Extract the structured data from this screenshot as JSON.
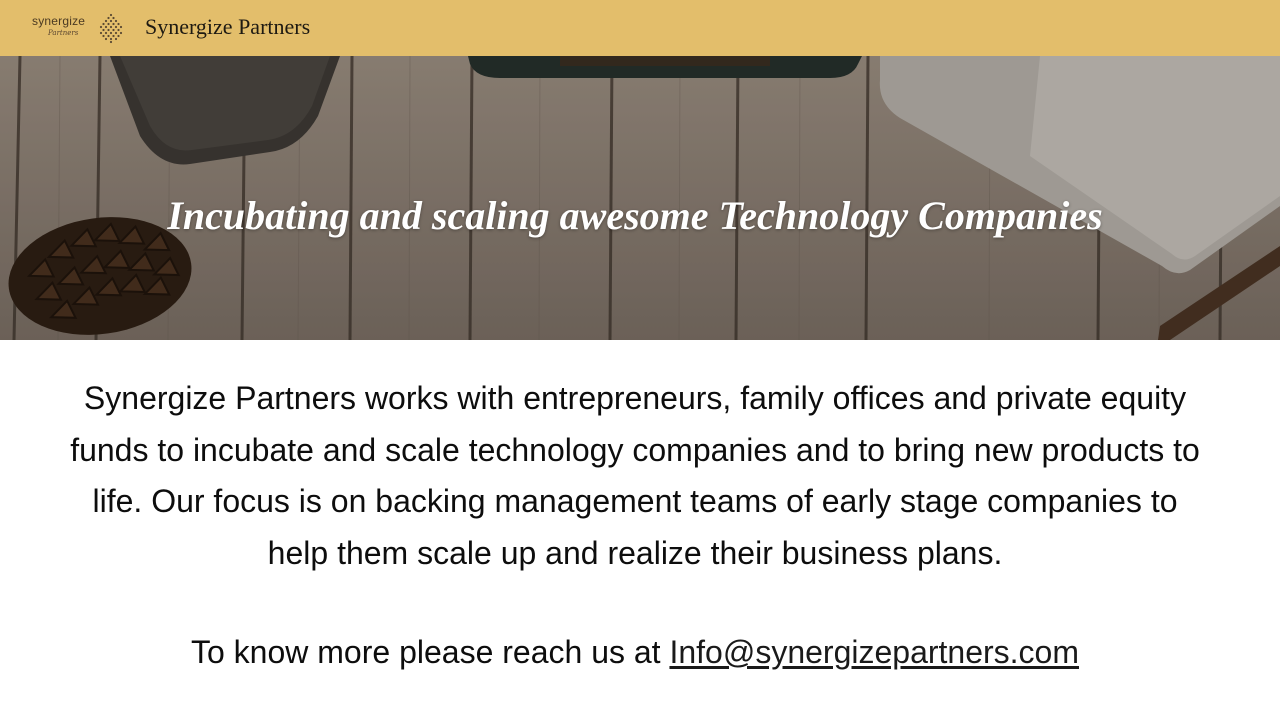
{
  "header": {
    "logo_word": "synergize",
    "logo_sub": "Partners",
    "site_name": "Synergize Partners",
    "bg_color": "#e3be6b"
  },
  "hero": {
    "title": "Incubating and scaling awesome Technology Companies"
  },
  "main": {
    "intro": "Synergize Partners works with entrepreneurs, family offices and private equity funds to incubate and scale technology companies and to bring new products to life. Our focus is on backing management teams of early stage companies to help them scale up and realize their business plans.",
    "contact_prefix": "To know more please reach us at ",
    "contact_email": "Info@synergizepartners.com"
  },
  "icons": {
    "logo_mark": "pine-cone-icon"
  }
}
